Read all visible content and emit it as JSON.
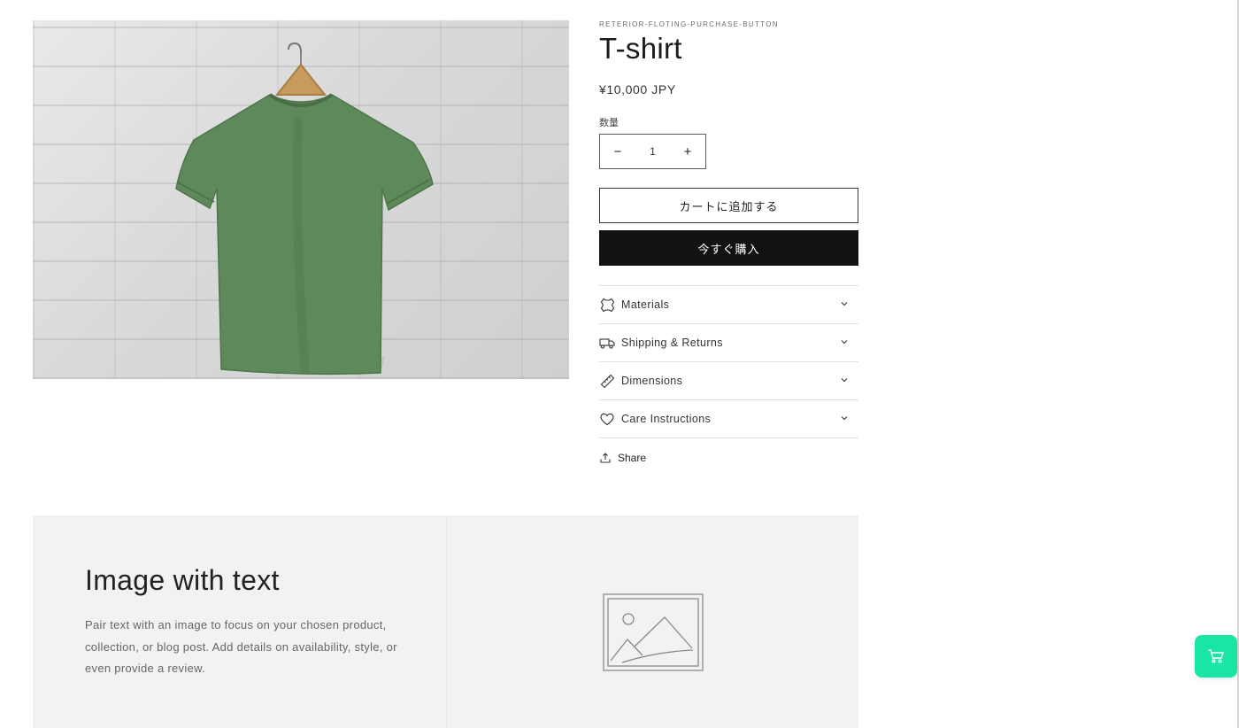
{
  "product": {
    "vendor": "RETERIOR-FLOTING-PURCHASE-BUTTON",
    "title": "T-shirt",
    "price": "¥10,000 JPY",
    "quantity_label": "数量",
    "quantity_value": "1",
    "decrease_symbol": "−",
    "increase_symbol": "+",
    "add_to_cart_label": "カートに追加する",
    "buy_now_label": "今すぐ購入",
    "share_label": "Share",
    "image_alt": "green t-shirt on hanger against white brick wall"
  },
  "accordion": [
    {
      "label": "Materials",
      "icon": "leather-icon"
    },
    {
      "label": "Shipping & Returns",
      "icon": "truck-icon"
    },
    {
      "label": "Dimensions",
      "icon": "ruler-icon"
    },
    {
      "label": "Care Instructions",
      "icon": "heart-icon"
    }
  ],
  "image_with_text": {
    "title": "Image with text",
    "text": "Pair text with an image to focus on your chosen product, collection, or blog post. Add details on availability, style, or even provide a review."
  },
  "colors": {
    "accent_button": "#121212",
    "floating_cart": "#19e5a4",
    "shirt": "#5e8a5b"
  }
}
